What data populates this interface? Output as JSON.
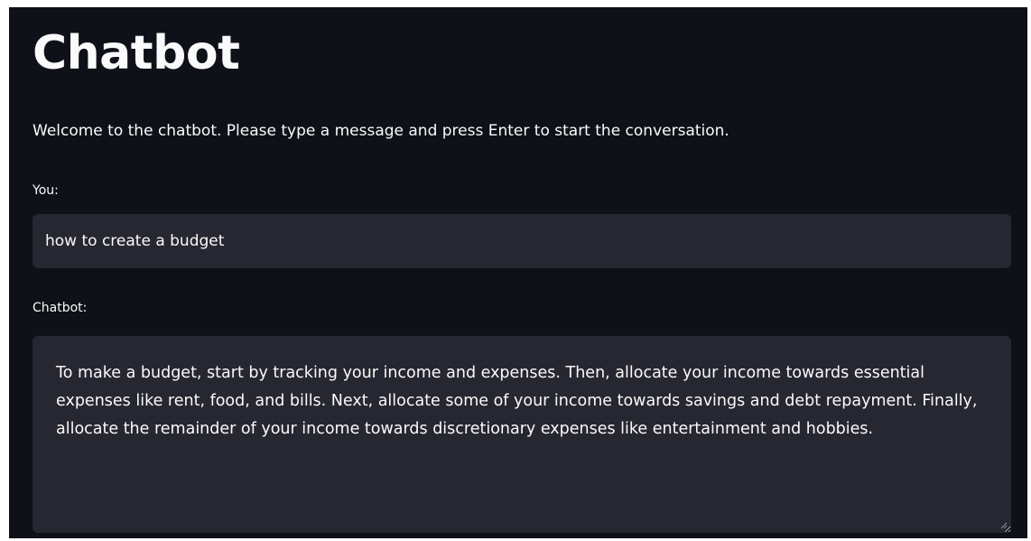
{
  "page": {
    "title": "Chatbot",
    "welcome_text": "Welcome to the chatbot. Please type a message and press Enter to start the conversation."
  },
  "user_input": {
    "label": "You:",
    "value": "how to create a budget"
  },
  "bot_output": {
    "label": "Chatbot:",
    "value": "To make a budget, start by tracking your income and expenses. Then, allocate your income towards essential expenses like rent, food, and bills. Next, allocate some of your income towards savings and debt repayment. Finally, allocate the remainder of your income towards discretionary expenses like entertainment and hobbies."
  },
  "colors": {
    "background": "#0e1117",
    "field_background": "#262730",
    "text": "#fafafa"
  },
  "icons": {
    "resize_handle": "resize-grip-icon"
  }
}
